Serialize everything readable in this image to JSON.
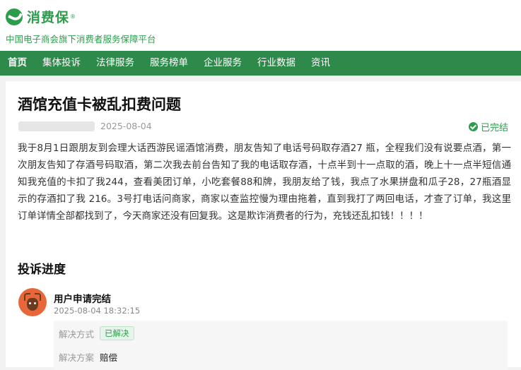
{
  "brand": {
    "name": "消费保",
    "reg_mark": "®",
    "tagline": "中国电子商会旗下消费者服务保障平台"
  },
  "nav": {
    "items": [
      {
        "label": "首页",
        "active": true
      },
      {
        "label": "集体投诉",
        "active": false
      },
      {
        "label": "法律服务",
        "active": false
      },
      {
        "label": "服务榜单",
        "active": false
      },
      {
        "label": "企业服务",
        "active": false
      },
      {
        "label": "行业数据",
        "active": false
      },
      {
        "label": "资讯",
        "active": false
      }
    ]
  },
  "complaint": {
    "title": "酒馆充值卡被乱扣费问题",
    "date": "2025-08-04",
    "status": "已完结",
    "content": "我于8月1日跟朋友到会理大话西游民谣酒馆消费，朋友告知了电话号码取存酒27 瓶，全程我们没有说要点酒，第一次朋友告知了存酒号码取酒，第二次我去前台告知了我的电话取存酒，十点半到十一点取的酒，晚上十一点半短信通知我充值的卡扣了我244，查看美团订单，小吃套餐88和牌，我朋友给了钱，我点了水果拼盘和瓜子28，27瓶酒显示的存酒扣了我 216。3号打电话问商家，商家以查监控慢为理由拖着，直到我打了两回电话，才查了订单，我这里订单详情全部都找到了，今天商家还没有回复我。这是欺诈消费者的行为，充钱还乱扣钱！！！！"
  },
  "progress": {
    "title": "投诉进度",
    "step": {
      "title": "用户申请完结",
      "time": "2025-08-04 18:32:15",
      "resolution_label": "解决方式",
      "resolution_badge": "已解决",
      "plan_label": "解决方案",
      "plan_value": "赔偿"
    }
  },
  "colors": {
    "brand_green": "#2e9c4d",
    "nav_bg": "#2e8a4a",
    "page_bg": "#f2f2f2"
  },
  "icons": {
    "logo": "checkmark-circle-logo",
    "status": "check-circle-icon",
    "avatar": "reindeer-avatar"
  }
}
